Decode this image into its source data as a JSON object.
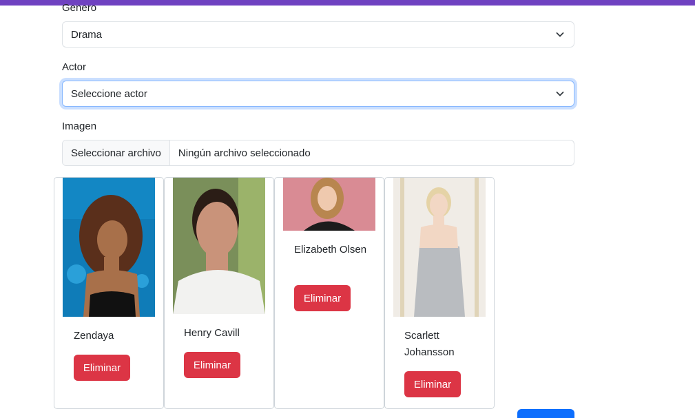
{
  "form": {
    "genre_label": "Genero",
    "genre_value": "Drama",
    "actor_label": "Actor",
    "actor_value": "Seleccione actor",
    "image_label": "Imagen",
    "file_button": "Seleccionar archivo",
    "file_status": "Ningún archivo seleccionado"
  },
  "actors": [
    {
      "name": "Zendaya",
      "delete_label": "Eliminar"
    },
    {
      "name": "Henry Cavill",
      "delete_label": "Eliminar"
    },
    {
      "name": "Elizabeth Olsen",
      "delete_label": "Eliminar"
    },
    {
      "name": "Scarlett Johansson",
      "delete_label": "Eliminar"
    }
  ],
  "colors": {
    "accent_bar": "#6f42c1",
    "danger": "#dc3545",
    "primary": "#0d6efd",
    "focus_border": "#86b7fe"
  },
  "icons": {
    "select_chevron": "chevron-down-icon"
  }
}
